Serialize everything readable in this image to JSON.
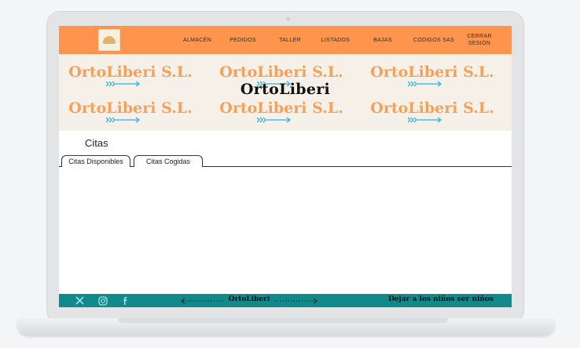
{
  "colors": {
    "nav_bg": "#ff944d",
    "banner_bg": "#f5f0e8",
    "banner_text": "#f6a15a",
    "arrow": "#2ab3e6",
    "footer_bg": "#108a8a"
  },
  "nav": {
    "logo_icon": "ortoliberi-logo",
    "items": [
      "ALMACÉN",
      "PEDIDOS",
      "TALLER",
      "LISTADOS",
      "BAJAS",
      "CODIGOS SAS",
      "CERRAR SESIÓN"
    ]
  },
  "banner": {
    "brand": "OrtoLiberi",
    "tiles": [
      "OrtoLiberi S.L.",
      "OrtoLiberi S.L.",
      "OrtoLiberi S.L.",
      "OrtoLiberi S.L.",
      "OrtoLiberi S.L.",
      "OrtoLiberi S.L."
    ]
  },
  "main": {
    "title": "Citas",
    "tabs": [
      {
        "label": "Citas Disponibles",
        "active": true
      },
      {
        "label": "Citas Cogidas",
        "active": false
      }
    ]
  },
  "footer": {
    "social_icons": [
      "x-icon",
      "instagram-icon",
      "facebook-icon"
    ],
    "brand": "OrtoLiberi",
    "tagline": "Dejar a los niños ser niños"
  }
}
